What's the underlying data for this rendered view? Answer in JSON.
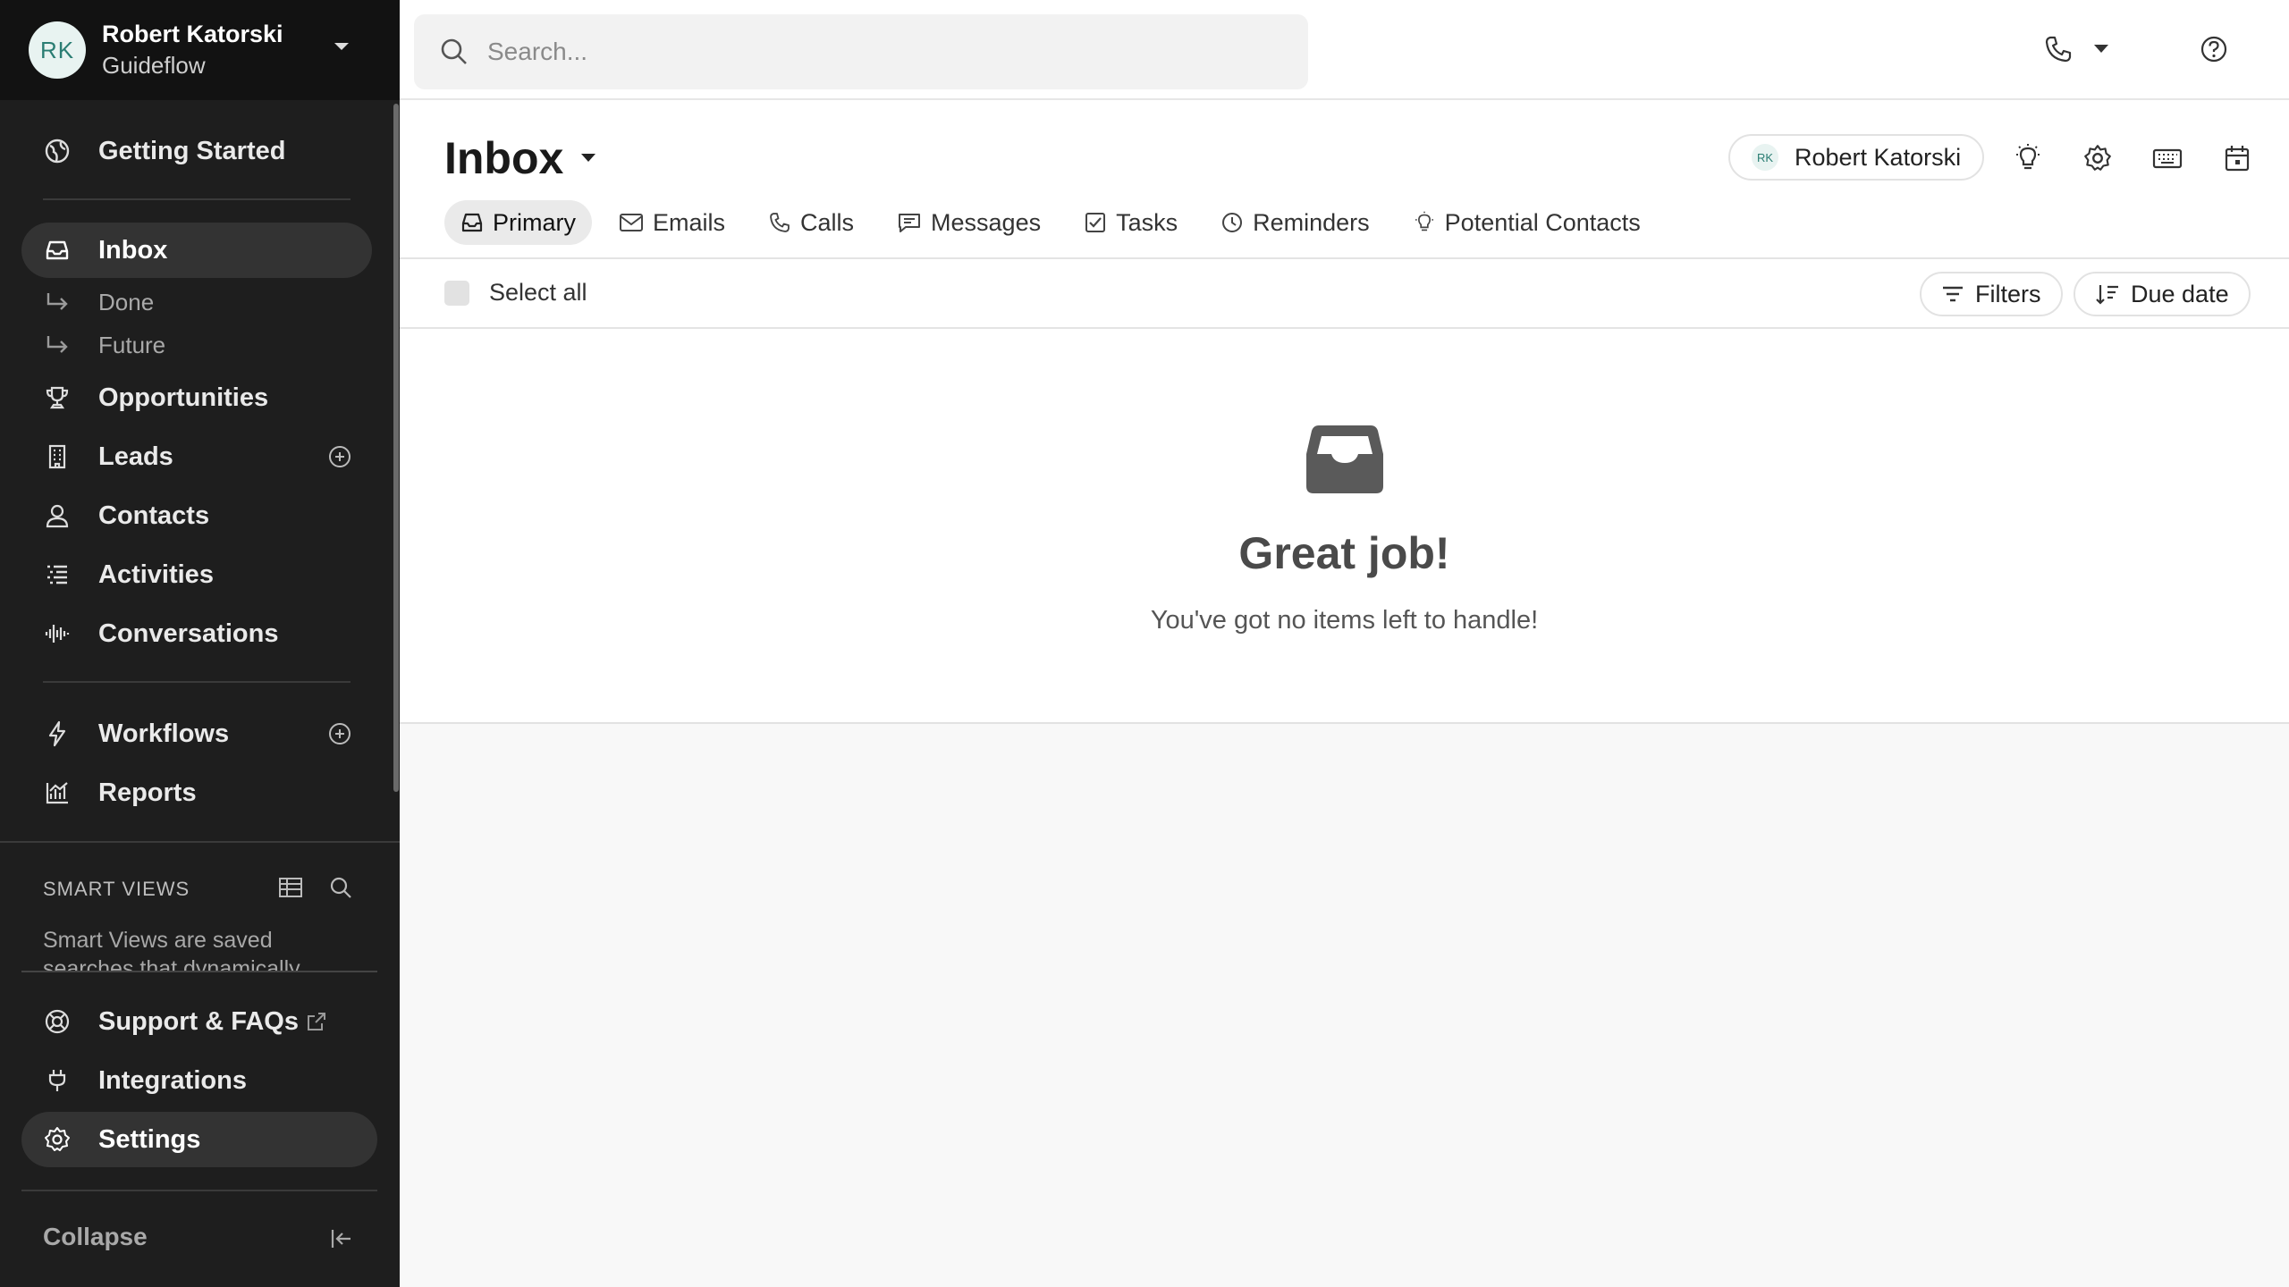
{
  "account": {
    "initials": "RK",
    "name": "Robert Katorski",
    "org": "Guideflow"
  },
  "sidebar": {
    "getting_started": "Getting Started",
    "inbox": "Inbox",
    "done": "Done",
    "future": "Future",
    "opportunities": "Opportunities",
    "leads": "Leads",
    "contacts": "Contacts",
    "activities": "Activities",
    "conversations": "Conversations",
    "workflows": "Workflows",
    "reports": "Reports",
    "smart_views_title": "SMART VIEWS",
    "smart_views_text": "Smart Views are saved searches that dynamically",
    "support": "Support & FAQs",
    "integrations": "Integrations",
    "settings": "Settings",
    "collapse": "Collapse"
  },
  "search": {
    "placeholder": "Search..."
  },
  "header": {
    "title": "Inbox",
    "user_initials": "RK",
    "user_name": "Robert Katorski"
  },
  "tabs": [
    {
      "label": "Primary",
      "icon": "inbox-icon"
    },
    {
      "label": "Emails",
      "icon": "mail-icon"
    },
    {
      "label": "Calls",
      "icon": "phone-icon"
    },
    {
      "label": "Messages",
      "icon": "message-icon"
    },
    {
      "label": "Tasks",
      "icon": "checkbox-icon"
    },
    {
      "label": "Reminders",
      "icon": "clock-icon"
    },
    {
      "label": "Potential Contacts",
      "icon": "lightbulb-icon"
    }
  ],
  "toolbar": {
    "select_all": "Select all",
    "filters": "Filters",
    "due_date": "Due date"
  },
  "empty_state": {
    "title": "Great job!",
    "subtitle": "You've got no items left to handle!"
  }
}
